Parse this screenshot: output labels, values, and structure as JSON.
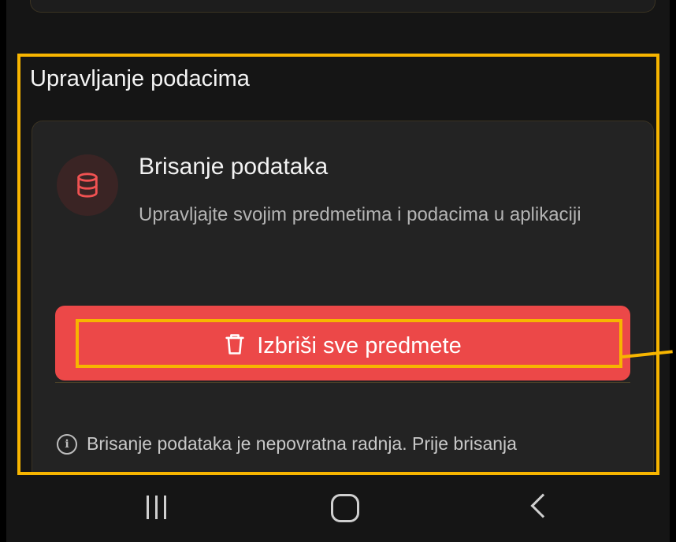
{
  "section": {
    "title": "Upravljanje podacima"
  },
  "card": {
    "icon": "database-icon",
    "title": "Brisanje podataka",
    "description": "Upravljajte svojim predmetima i podacima u aplikaciji",
    "delete_button": {
      "icon": "trash-icon",
      "label": "Izbriši sve predmete"
    },
    "info": {
      "icon": "info-icon",
      "text": "Brisanje podataka je nepovratna radnja. Prije brisanja"
    }
  },
  "nav": {
    "recent_icon": "recent-apps-icon",
    "home_icon": "home-icon",
    "back_icon": "back-icon"
  },
  "colors": {
    "background": "#151515",
    "card": "#232323",
    "danger": "#ec4848",
    "highlight": "#f7b500"
  }
}
